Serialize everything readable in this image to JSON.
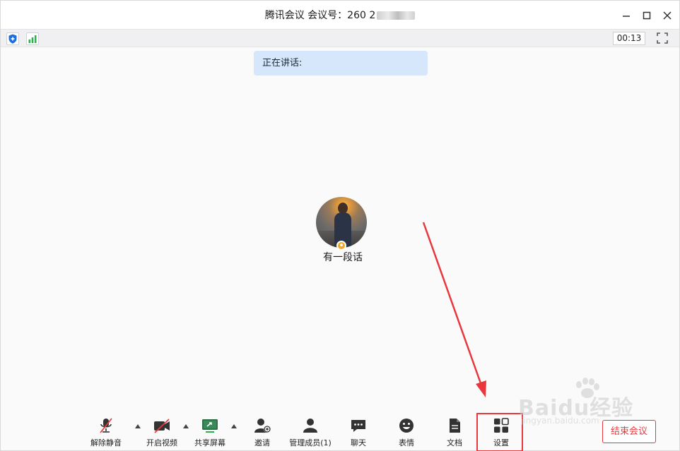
{
  "window": {
    "title": "腾讯会议 会议号：260 2",
    "title_suffix": " ·"
  },
  "status_bar": {
    "timer": "00:13"
  },
  "speaking": {
    "label": "正在讲话:"
  },
  "participant": {
    "name": "有一段话"
  },
  "toolbar": {
    "unmute_label": "解除静音",
    "video_label": "开启视频",
    "share_label": "共享屏幕",
    "invite_label": "邀请",
    "members_label": "管理成员(1)",
    "chat_label": "聊天",
    "emoji_label": "表情",
    "docs_label": "文档",
    "settings_label": "设置",
    "end_label": "结束会议"
  },
  "watermark": {
    "main": "Baidu经验",
    "sub": "jingyan.baidu.com"
  },
  "colors": {
    "accent_red": "#e8383d",
    "speaking_bg": "#d6e6fb",
    "signal_green": "#2bb24c",
    "shield_blue": "#1e6fd9",
    "host_badge": "#f5a623"
  }
}
